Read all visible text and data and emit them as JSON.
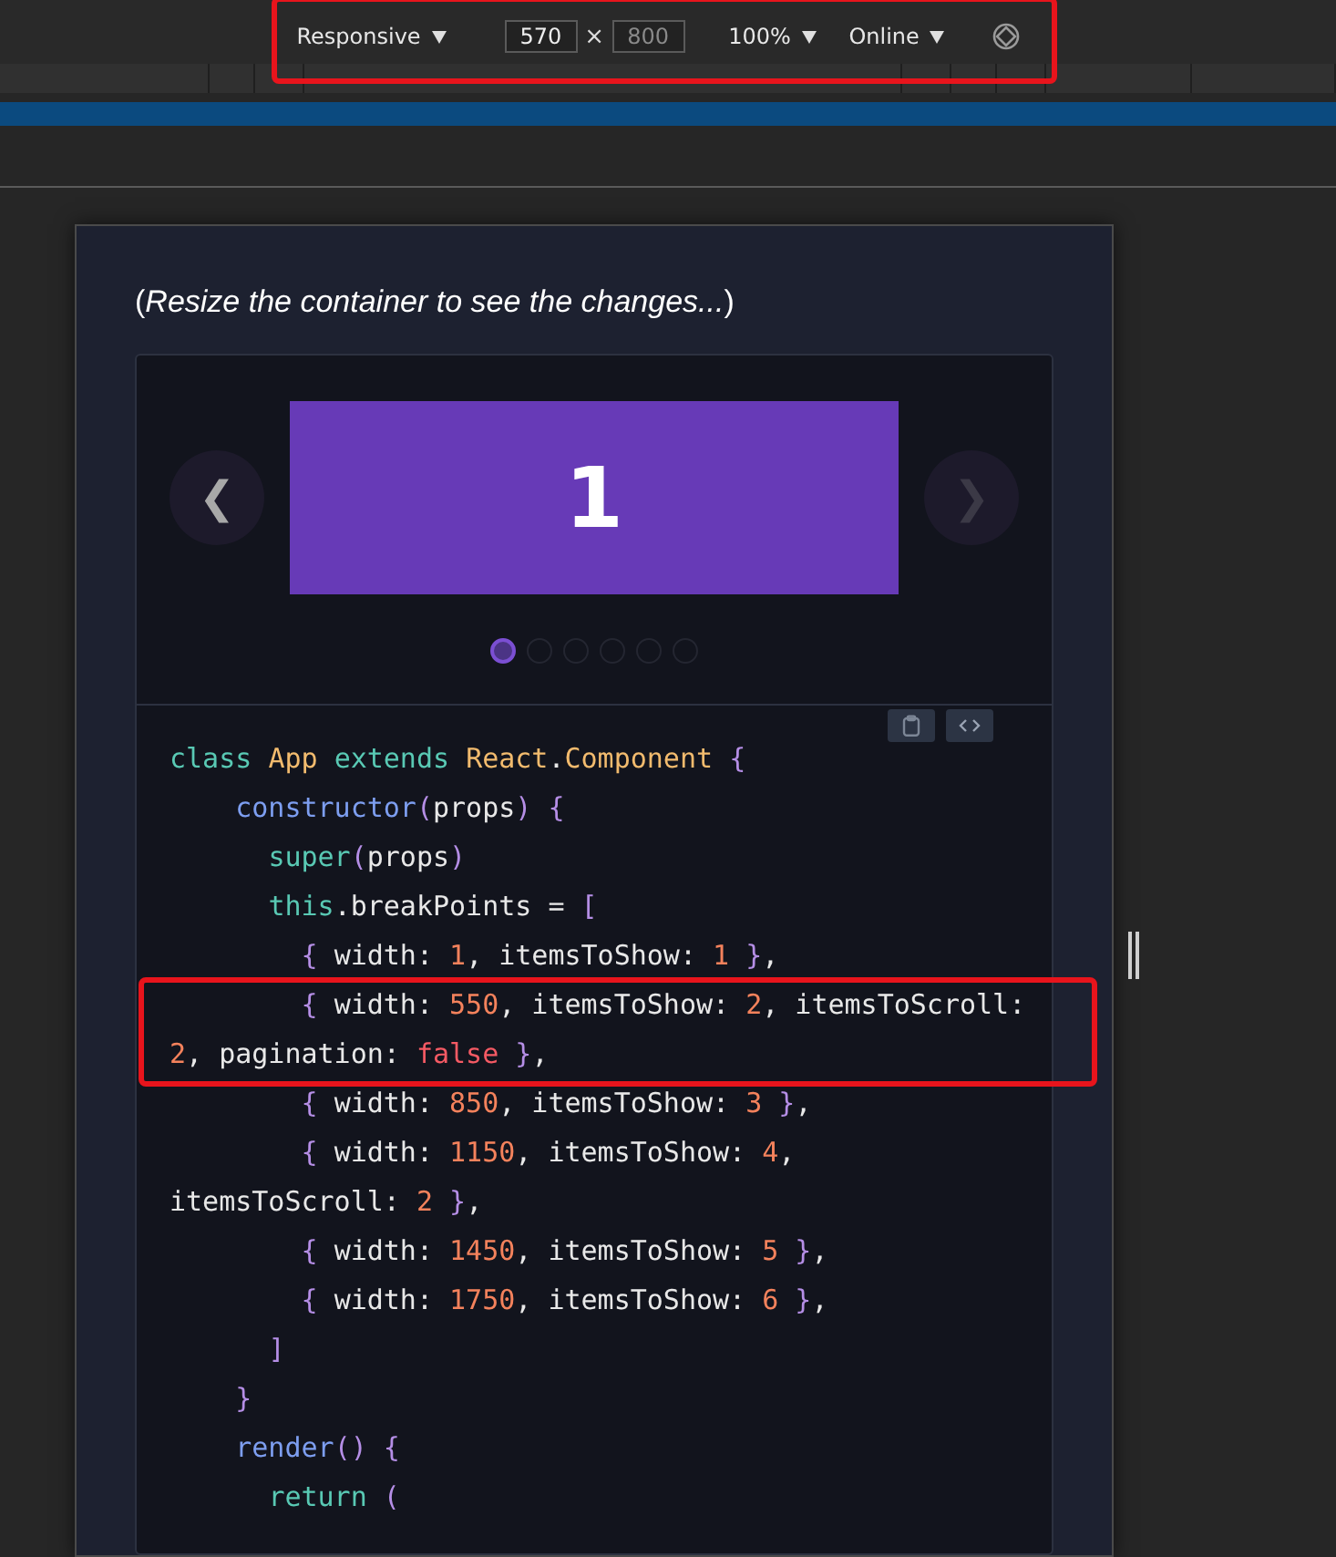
{
  "toolbar": {
    "highlighted": true,
    "device": "Responsive",
    "width_value": "570",
    "times": "×",
    "height_value": "800",
    "zoom": "100%",
    "network": "Online"
  },
  "intro": "(*Resize the container to see the changes...*)",
  "carousel": {
    "prev": "❮",
    "next": "❯",
    "slide": "1",
    "dots": [
      {
        "selected": true
      },
      {
        "selected": false
      },
      {
        "selected": false
      },
      {
        "selected": false
      },
      {
        "selected": false
      },
      {
        "selected": false
      }
    ]
  },
  "code": [
    {
      "highlighted": false,
      "tokens": [
        {
          "kind": "kw",
          "text": "class "
        },
        {
          "kind": "type",
          "text": "App "
        },
        {
          "kind": "kw",
          "text": "extends "
        },
        {
          "kind": "type",
          "text": "React"
        },
        {
          "kind": "plain",
          "text": "."
        },
        {
          "kind": "type",
          "text": "Component "
        },
        {
          "kind": "punc",
          "text": "{"
        }
      ]
    },
    {
      "highlighted": false,
      "tokens": [
        {
          "kind": "fn",
          "text": "    constructor"
        },
        {
          "kind": "punc",
          "text": "("
        },
        {
          "kind": "plain",
          "text": "props"
        },
        {
          "kind": "punc",
          "text": ") {"
        }
      ]
    },
    {
      "highlighted": false,
      "tokens": [
        {
          "kind": "kw",
          "text": "      super"
        },
        {
          "kind": "punc",
          "text": "("
        },
        {
          "kind": "plain",
          "text": "props"
        },
        {
          "kind": "punc",
          "text": ")"
        }
      ]
    },
    {
      "highlighted": false,
      "tokens": [
        {
          "kind": "kw",
          "text": "      this"
        },
        {
          "kind": "plain",
          "text": ".breakPoints = "
        },
        {
          "kind": "punc",
          "text": "["
        }
      ]
    },
    {
      "highlighted": false,
      "tokens": [
        {
          "kind": "punc",
          "text": "        { "
        },
        {
          "kind": "plain",
          "text": "width: "
        },
        {
          "kind": "num",
          "text": "1"
        },
        {
          "kind": "plain",
          "text": ", itemsToShow: "
        },
        {
          "kind": "num",
          "text": "1"
        },
        {
          "kind": "punc",
          "text": " }"
        },
        {
          "kind": "plain",
          "text": ","
        }
      ]
    },
    {
      "highlighted": true,
      "tokens": [
        {
          "kind": "punc",
          "text": "        { "
        },
        {
          "kind": "plain",
          "text": "width: "
        },
        {
          "kind": "num",
          "text": "550"
        },
        {
          "kind": "plain",
          "text": ", itemsToShow: "
        },
        {
          "kind": "num",
          "text": "2"
        },
        {
          "kind": "plain",
          "text": ", itemsToScroll: "
        },
        {
          "kind": "num",
          "text": "2"
        },
        {
          "kind": "plain",
          "text": ", pagination: "
        },
        {
          "kind": "bool",
          "text": "false"
        },
        {
          "kind": "punc",
          "text": " }"
        },
        {
          "kind": "plain",
          "text": ","
        }
      ]
    },
    {
      "highlighted": false,
      "tokens": [
        {
          "kind": "punc",
          "text": "        { "
        },
        {
          "kind": "plain",
          "text": "width: "
        },
        {
          "kind": "num",
          "text": "850"
        },
        {
          "kind": "plain",
          "text": ", itemsToShow: "
        },
        {
          "kind": "num",
          "text": "3"
        },
        {
          "kind": "punc",
          "text": " }"
        },
        {
          "kind": "plain",
          "text": ","
        }
      ]
    },
    {
      "highlighted": false,
      "tokens": [
        {
          "kind": "punc",
          "text": "        { "
        },
        {
          "kind": "plain",
          "text": "width: "
        },
        {
          "kind": "num",
          "text": "1150"
        },
        {
          "kind": "plain",
          "text": ", itemsToShow: "
        },
        {
          "kind": "num",
          "text": "4"
        },
        {
          "kind": "plain",
          "text": ", itemsToScroll: "
        },
        {
          "kind": "num",
          "text": "2"
        },
        {
          "kind": "punc",
          "text": " }"
        },
        {
          "kind": "plain",
          "text": ","
        }
      ]
    },
    {
      "highlighted": false,
      "tokens": [
        {
          "kind": "punc",
          "text": "        { "
        },
        {
          "kind": "plain",
          "text": "width: "
        },
        {
          "kind": "num",
          "text": "1450"
        },
        {
          "kind": "plain",
          "text": ", itemsToShow: "
        },
        {
          "kind": "num",
          "text": "5"
        },
        {
          "kind": "punc",
          "text": " }"
        },
        {
          "kind": "plain",
          "text": ","
        }
      ]
    },
    {
      "highlighted": false,
      "tokens": [
        {
          "kind": "punc",
          "text": "        { "
        },
        {
          "kind": "plain",
          "text": "width: "
        },
        {
          "kind": "num",
          "text": "1750"
        },
        {
          "kind": "plain",
          "text": ", itemsToShow: "
        },
        {
          "kind": "num",
          "text": "6"
        },
        {
          "kind": "punc",
          "text": " }"
        },
        {
          "kind": "plain",
          "text": ","
        }
      ]
    },
    {
      "highlighted": false,
      "tokens": [
        {
          "kind": "punc",
          "text": "      ]"
        }
      ]
    },
    {
      "highlighted": false,
      "tokens": [
        {
          "kind": "punc",
          "text": "    }"
        }
      ]
    },
    {
      "highlighted": false,
      "tokens": [
        {
          "kind": "fn",
          "text": "    render"
        },
        {
          "kind": "punc",
          "text": "() {"
        }
      ]
    },
    {
      "highlighted": false,
      "tokens": [
        {
          "kind": "kw",
          "text": "      return "
        },
        {
          "kind": "punc",
          "text": "("
        }
      ]
    }
  ]
}
